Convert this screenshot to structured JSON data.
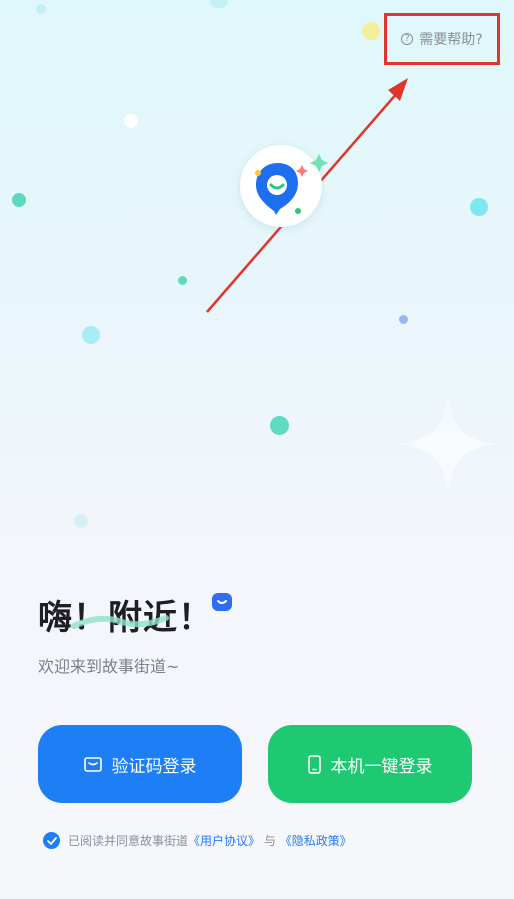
{
  "help": {
    "label": "需要帮助?",
    "icon": "question-circle-icon"
  },
  "headline": {
    "part1": "嗨！",
    "part2": "附近！"
  },
  "subtitle": "欢迎来到故事街道~",
  "buttons": {
    "code_login": {
      "label": "验证码登录",
      "icon": "message-icon",
      "color": "#1e7ef5"
    },
    "phone_login": {
      "label": "本机一键登录",
      "icon": "phone-icon",
      "color": "#1ec972"
    }
  },
  "agreement": {
    "prefix": "已阅读并同意故事街道",
    "user_agreement": "《用户协议》",
    "and": "与",
    "privacy_policy": "《隐私政策》"
  },
  "colors": {
    "annotation": "#e0352b",
    "primary": "#1e7ef5",
    "secondary": "#1ec972"
  }
}
